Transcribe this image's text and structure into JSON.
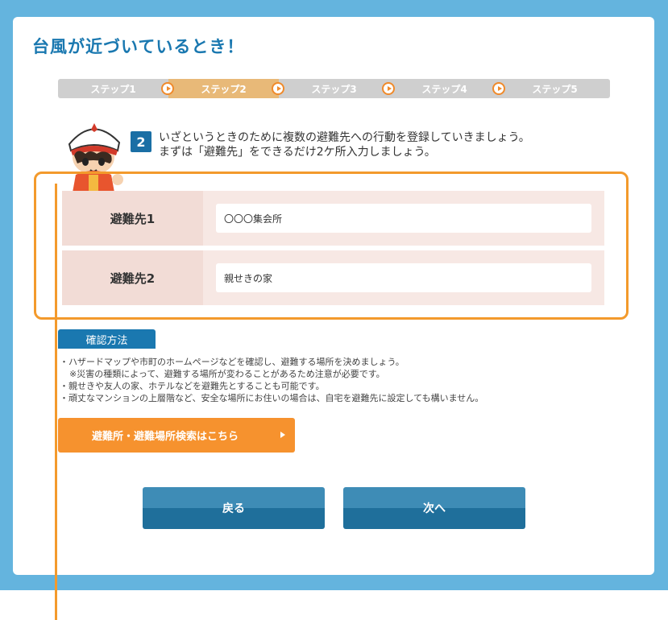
{
  "page": {
    "title": "台風が近づいているとき！"
  },
  "steps": [
    {
      "label": "ステップ1",
      "active": false
    },
    {
      "label": "ステップ2",
      "active": true
    },
    {
      "label": "ステップ3",
      "active": false
    },
    {
      "label": "ステップ4",
      "active": false
    },
    {
      "label": "ステップ5",
      "active": false
    }
  ],
  "instruction": {
    "step_number": "2",
    "line1": "いざというときのために複数の避難先への行動を登録していきましょう。",
    "line2": "まずは「避難先」をできるだけ2ケ所入力しましょう。"
  },
  "form": {
    "rows": [
      {
        "label": "避難先1",
        "value": "〇〇〇集会所"
      },
      {
        "label": "避難先2",
        "value": "親せきの家"
      }
    ]
  },
  "confirm": {
    "tab_label": "確認方法",
    "notes": [
      "・ハザードマップや市町のホームページなどを確認し、避難する場所を決めましょう。",
      "※災害の種類によって、避難する場所が変わることがあるため注意が必要です。",
      "・親せきや友人の家、ホテルなどを避難先とすることも可能です。",
      "・頑丈なマンションの上層階など、安全な場所にお住いの場合は、自宅を避難先に設定しても構いません。"
    ]
  },
  "search_button": {
    "label": "避難所・避難場所検索はこちら"
  },
  "nav": {
    "back_label": "戻る",
    "next_label": "次へ"
  },
  "colors": {
    "frame": "#64b4de",
    "accent": "#f39a2c",
    "primary": "#1a78b0"
  }
}
